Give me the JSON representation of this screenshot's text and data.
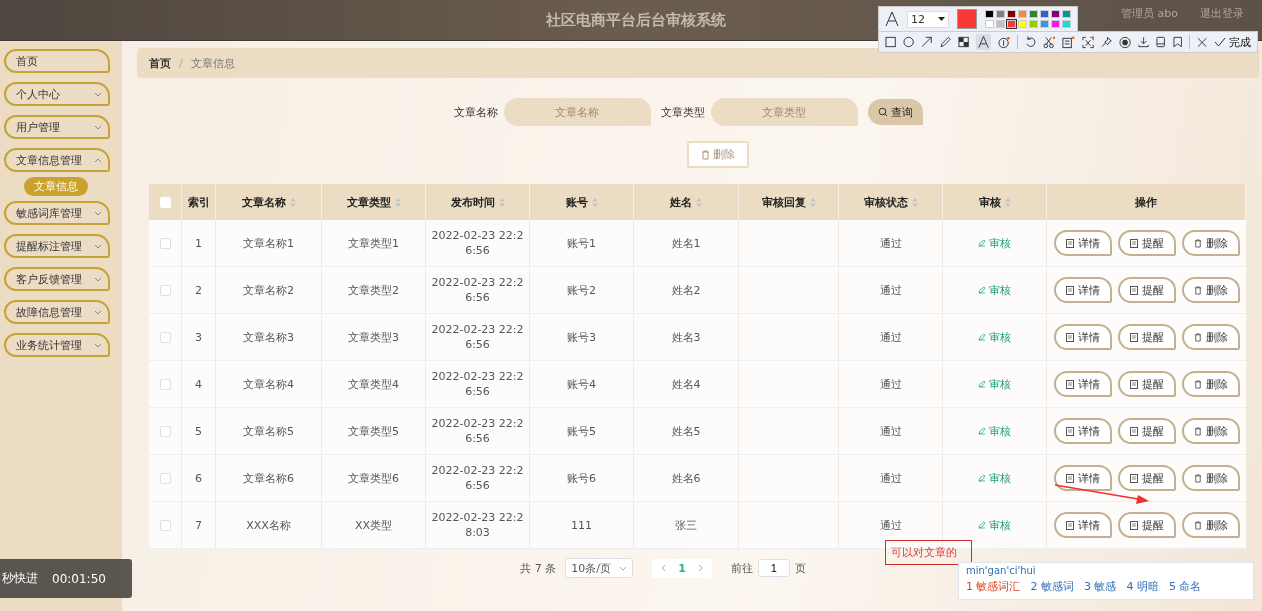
{
  "header": {
    "title": "社区电商平台后台审核系统",
    "user": "管理员 abo",
    "logout": "退出登录"
  },
  "sidebar": {
    "items": [
      {
        "label": "首页",
        "kind": "link"
      },
      {
        "label": "个人中心",
        "kind": "group",
        "expanded": false
      },
      {
        "label": "用户管理",
        "kind": "group",
        "expanded": false
      },
      {
        "label": "文章信息管理",
        "kind": "group",
        "expanded": true,
        "children": [
          {
            "label": "文章信息",
            "selected": true
          }
        ]
      },
      {
        "label": "敏感词库管理",
        "kind": "group",
        "expanded": false
      },
      {
        "label": "提醒标注管理",
        "kind": "group",
        "expanded": false
      },
      {
        "label": "客户反馈管理",
        "kind": "group",
        "expanded": false
      },
      {
        "label": "故障信息管理",
        "kind": "group",
        "expanded": false
      },
      {
        "label": "业务统计管理",
        "kind": "group",
        "expanded": false
      }
    ]
  },
  "breadcrumb": {
    "separator": "/",
    "items": [
      "首页",
      "文章信息"
    ]
  },
  "search": {
    "fields": [
      {
        "label": "文章名称",
        "placeholder": "文章名称"
      },
      {
        "label": "文章类型",
        "placeholder": "文章类型"
      }
    ],
    "button": "查询"
  },
  "batch_delete": {
    "label": "删除",
    "disabled": true
  },
  "table": {
    "header_checked": false,
    "columns": [
      {
        "label": "索引",
        "sortable": false
      },
      {
        "label": "文章名称",
        "sortable": true
      },
      {
        "label": "文章类型",
        "sortable": true
      },
      {
        "label": "发布时间",
        "sortable": true
      },
      {
        "label": "账号",
        "sortable": true
      },
      {
        "label": "姓名",
        "sortable": true
      },
      {
        "label": "审核回复",
        "sortable": true
      },
      {
        "label": "审核状态",
        "sortable": true
      },
      {
        "label": "审核",
        "sortable": true
      },
      {
        "label": "操作",
        "sortable": false
      }
    ],
    "rows": [
      {
        "checked": false,
        "index": "1",
        "name": "文章名称1",
        "type": "文章类型1",
        "time": "2022-02-23 22:26:56",
        "account": "账号1",
        "person": "姓名1",
        "reply": "",
        "status": "通过",
        "review": "审核",
        "actions": [
          "详情",
          "提醒",
          "删除"
        ]
      },
      {
        "checked": false,
        "index": "2",
        "name": "文章名称2",
        "type": "文章类型2",
        "time": "2022-02-23 22:26:56",
        "account": "账号2",
        "person": "姓名2",
        "reply": "",
        "status": "通过",
        "review": "审核",
        "actions": [
          "详情",
          "提醒",
          "删除"
        ]
      },
      {
        "checked": false,
        "index": "3",
        "name": "文章名称3",
        "type": "文章类型3",
        "time": "2022-02-23 22:26:56",
        "account": "账号3",
        "person": "姓名3",
        "reply": "",
        "status": "通过",
        "review": "审核",
        "actions": [
          "详情",
          "提醒",
          "删除"
        ]
      },
      {
        "checked": false,
        "index": "4",
        "name": "文章名称4",
        "type": "文章类型4",
        "time": "2022-02-23 22:26:56",
        "account": "账号4",
        "person": "姓名4",
        "reply": "",
        "status": "通过",
        "review": "审核",
        "actions": [
          "详情",
          "提醒",
          "删除"
        ]
      },
      {
        "checked": false,
        "index": "5",
        "name": "文章名称5",
        "type": "文章类型5",
        "time": "2022-02-23 22:26:56",
        "account": "账号5",
        "person": "姓名5",
        "reply": "",
        "status": "通过",
        "review": "审核",
        "actions": [
          "详情",
          "提醒",
          "删除"
        ]
      },
      {
        "checked": false,
        "index": "6",
        "name": "文章名称6",
        "type": "文章类型6",
        "time": "2022-02-23 22:26:56",
        "account": "账号6",
        "person": "姓名6",
        "reply": "",
        "status": "通过",
        "review": "审核",
        "actions": [
          "详情",
          "提醒",
          "删除"
        ]
      },
      {
        "checked": false,
        "index": "7",
        "name": "XXX名称",
        "type": "XX类型",
        "time": "2022-02-23 22:28:03",
        "account": "111",
        "person": "张三",
        "reply": "",
        "status": "通过",
        "review": "审核",
        "actions": [
          "详情",
          "提醒",
          "删除"
        ]
      }
    ]
  },
  "pagination": {
    "total": "共 7 条",
    "page_size": "10条/页",
    "pages": [
      {
        "label": "1",
        "selected": true
      }
    ],
    "goto_label": "前往",
    "goto_value": "1",
    "goto_suffix": "页"
  },
  "annotation_toolbar": {
    "font_size": "12",
    "swatches": [
      {
        "color": "#000000",
        "selected": false
      },
      {
        "color": "#808080",
        "selected": false
      },
      {
        "color": "#800000",
        "selected": false
      },
      {
        "color": "#f7883a",
        "selected": false
      },
      {
        "color": "#308430",
        "selected": false
      },
      {
        "color": "#385ad3",
        "selected": false
      },
      {
        "color": "#800080",
        "selected": false
      },
      {
        "color": "#009999",
        "selected": false
      },
      {
        "color": "#ffffff",
        "selected": false
      },
      {
        "color": "#c0c0c0",
        "selected": false
      },
      {
        "color": "#fb3838",
        "selected": true
      },
      {
        "color": "#ffff00",
        "selected": false
      },
      {
        "color": "#99cc00",
        "selected": false
      },
      {
        "color": "#3894e4",
        "selected": false
      },
      {
        "color": "#f31bf3",
        "selected": false
      },
      {
        "color": "#16dcdc",
        "selected": false
      }
    ],
    "done": "完成"
  },
  "text_annotation": "可以对文章的",
  "ime": {
    "input": "min'gan'ci'hui",
    "candidates": [
      {
        "number": "1",
        "text": "敏感词汇",
        "selected": true
      },
      {
        "number": "2",
        "text": "敏感词",
        "selected": false
      },
      {
        "number": "3",
        "text": "敏感",
        "selected": false
      },
      {
        "number": "4",
        "text": "明暗",
        "selected": false
      },
      {
        "number": "5",
        "text": "命名",
        "selected": false
      }
    ]
  },
  "video_overlay": {
    "label": "秒快进",
    "time": "00:01:50"
  }
}
